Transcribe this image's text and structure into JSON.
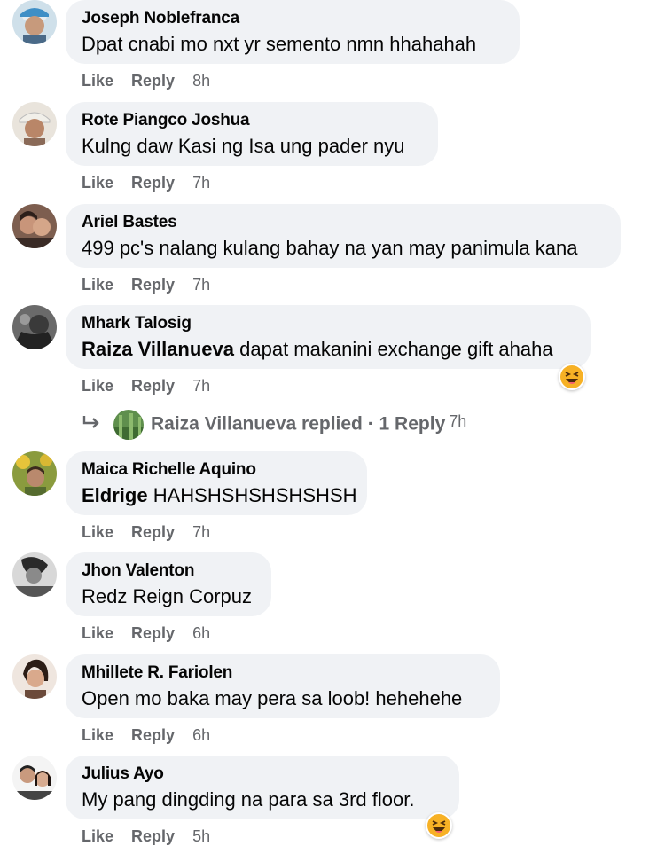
{
  "actions": {
    "like": "Like",
    "reply": "Reply"
  },
  "comments": [
    {
      "author": "Joseph Noblefranca",
      "text": "Dpat cnabi mo nxt yr semento nmn hhahahah",
      "mention": "",
      "time": "8h",
      "reaction": ""
    },
    {
      "author": "Rote Piangco Joshua",
      "text": "Kulng daw Kasi ng Isa ung pader nyu",
      "mention": "",
      "time": "7h",
      "reaction": ""
    },
    {
      "author": "Ariel Bastes",
      "text": "499 pc's nalang kulang bahay na yan may panimula kana",
      "mention": "",
      "time": "7h",
      "reaction": ""
    },
    {
      "author": "Mhark Talosig",
      "mention": "Raiza Villanueva",
      "text": " dapat makanini exchange gift ahaha",
      "time": "7h",
      "reaction": "haha-icon"
    },
    {
      "author": "Maica Richelle Aquino",
      "mention": "Eldrige",
      "text": " HAHSHSHSHSHSHSH",
      "time": "7h",
      "reaction": ""
    },
    {
      "author": "Jhon Valenton",
      "text": "Redz Reign Corpuz",
      "mention": "",
      "time": "6h",
      "reaction": ""
    },
    {
      "author": "Mhillete R. Fariolen",
      "text": "Open mo baka may pera sa loob! hehehehe",
      "mention": "",
      "time": "6h",
      "reaction": ""
    },
    {
      "author": "Julius Ayo",
      "text": "My pang dingding na para sa 3rd floor.",
      "mention": "",
      "time": "5h",
      "reaction": "haha-icon"
    }
  ],
  "replies_row": {
    "replier": "Raiza Villanueva",
    "label": "Raiza Villanueva replied · 1 Reply",
    "time": "7h"
  },
  "colors": {
    "bubble": "#f0f2f5",
    "secondary_text": "#65676b",
    "primary_text": "#050505"
  }
}
